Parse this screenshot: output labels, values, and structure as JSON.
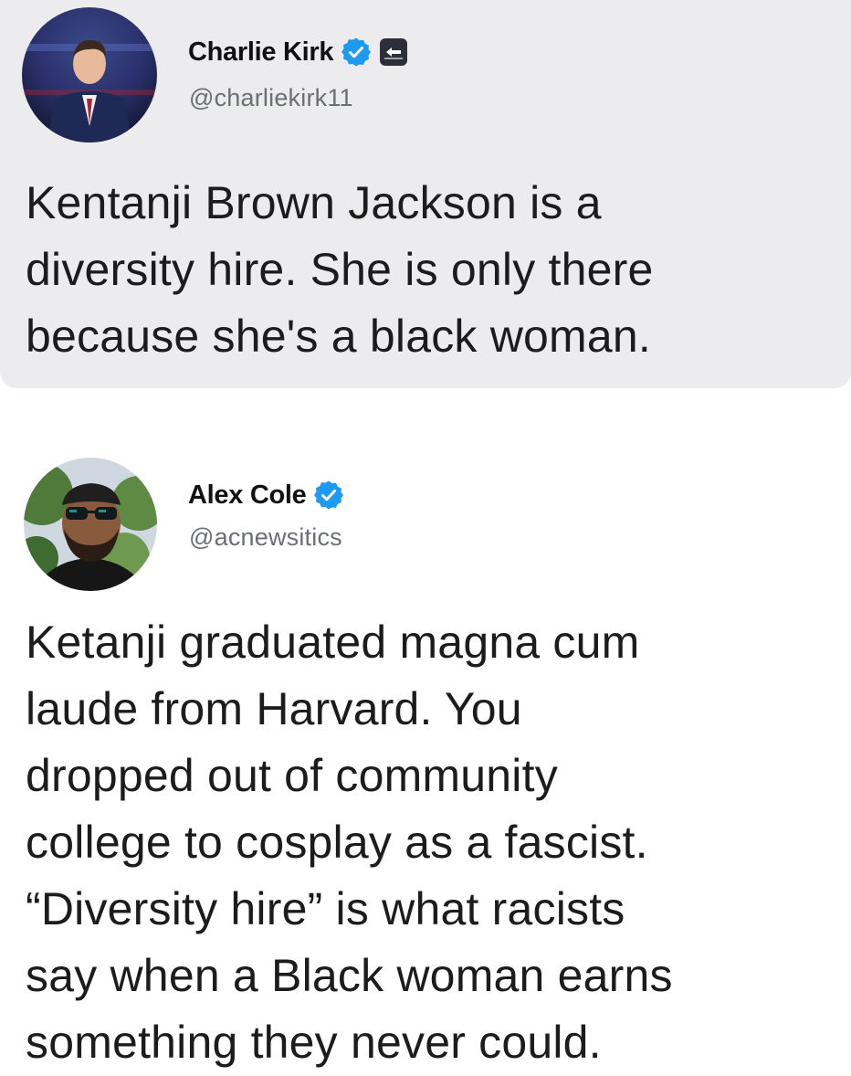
{
  "tweets": [
    {
      "author": {
        "name": "Charlie Kirk",
        "handle": "@charliekirk11",
        "verified": true,
        "affiliation_badge": true
      },
      "text_lines": [
        "Kentanji Brown Jackson is a",
        "diversity hire. She is only there",
        "because she's a black woman."
      ]
    },
    {
      "author": {
        "name": "Alex Cole",
        "handle": "@acnewsitics",
        "verified": true
      },
      "text_lines": [
        "Ketanji graduated magna cum",
        "laude from Harvard. You",
        "dropped out of community",
        "college to cosplay as a fascist.",
        "“Diversity hire” is what racists",
        "say when a Black woman earns",
        "something they never could."
      ]
    }
  ],
  "colors": {
    "quoted_tweet_bg": "#ececee",
    "verified_blue": "#1d9bf0",
    "handle_gray": "#6b6f75"
  },
  "icons": [
    "verified-badge-icon",
    "affiliation-badge-icon"
  ]
}
